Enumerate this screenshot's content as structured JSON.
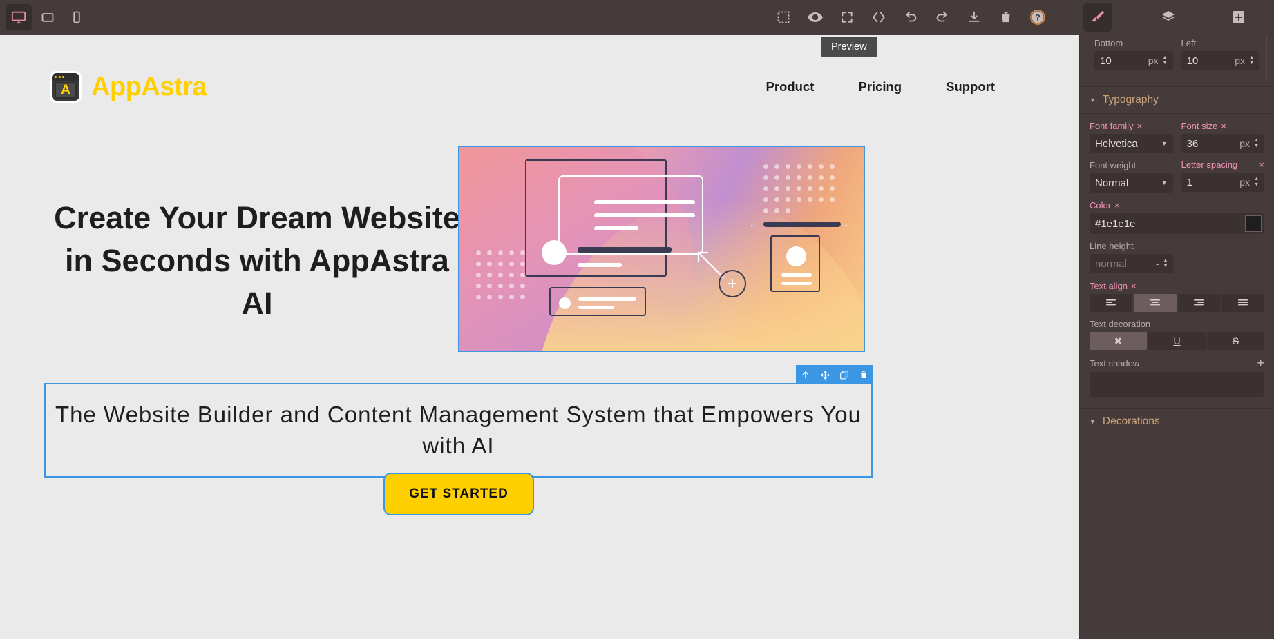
{
  "topbar": {
    "devices": [
      {
        "name": "desktop",
        "label": "Desktop",
        "active": true
      },
      {
        "name": "tablet",
        "label": "Tablet",
        "active": false
      },
      {
        "name": "mobile",
        "label": "Mobile",
        "active": false
      }
    ],
    "tools": [
      {
        "name": "borders",
        "label": "View components"
      },
      {
        "name": "preview",
        "label": "Preview"
      },
      {
        "name": "fullscreen",
        "label": "Fullscreen"
      },
      {
        "name": "code",
        "label": "View code"
      },
      {
        "name": "undo",
        "label": "Undo"
      },
      {
        "name": "redo",
        "label": "Redo"
      },
      {
        "name": "import",
        "label": "Import"
      },
      {
        "name": "clear",
        "label": "Clear canvas"
      },
      {
        "name": "help",
        "label": "Help"
      }
    ],
    "panels": [
      {
        "name": "style-manager",
        "label": "Style Manager",
        "active": true
      },
      {
        "name": "layer-manager",
        "label": "Layer Manager",
        "active": false
      },
      {
        "name": "blocks",
        "label": "Open Blocks",
        "active": false
      }
    ],
    "tooltip": "Preview"
  },
  "site": {
    "logo_text": "AppAstra",
    "logo_letter": "A",
    "nav": [
      "Product",
      "Pricing",
      "Support"
    ],
    "headline": "Create Your Dream Website in Seconds with AppAstra AI",
    "subheading": "The Website Builder and Content Management System that Empowers You with AI",
    "cta": "GET STARTED"
  },
  "selection_toolbar": [
    {
      "name": "select-parent",
      "label": "Select parent"
    },
    {
      "name": "move",
      "label": "Move"
    },
    {
      "name": "copy",
      "label": "Copy"
    },
    {
      "name": "delete",
      "label": "Delete"
    }
  ],
  "style_panel": {
    "spacing": {
      "bottom": {
        "label": "Bottom",
        "value": "10",
        "unit": "px"
      },
      "left": {
        "label": "Left",
        "value": "10",
        "unit": "px"
      }
    },
    "typography": {
      "title": "Typography",
      "font_family": {
        "label": "Font family",
        "value": "Helvetica",
        "cleared": "×"
      },
      "font_size": {
        "label": "Font size",
        "value": "36",
        "unit": "px",
        "cleared": "×"
      },
      "font_weight": {
        "label": "Font weight",
        "value": "Normal"
      },
      "letter_spacing": {
        "label": "Letter spacing",
        "value": "1",
        "unit": "px",
        "cleared": "×"
      },
      "color": {
        "label": "Color",
        "value": "#1e1e1e",
        "cleared": "×"
      },
      "line_height": {
        "label": "Line height",
        "value": "normal",
        "unit": "-"
      },
      "text_align": {
        "label": "Text align",
        "cleared": "×",
        "active": 1,
        "options": [
          "left",
          "center",
          "right",
          "justify"
        ]
      },
      "text_decoration": {
        "label": "Text decoration",
        "active": 0,
        "options": [
          "none",
          "underline",
          "line-through"
        ],
        "glyphs": [
          "✖",
          "U",
          "S"
        ]
      },
      "text_shadow": {
        "label": "Text shadow",
        "add": "+"
      }
    },
    "decorations": {
      "title": "Decorations"
    }
  },
  "colors": {
    "accent_pink": "#ef92b6",
    "selection_blue": "#3b97e3",
    "brand_yellow": "#ffd000",
    "panel_bg": "#463b3b",
    "canvas_bg": "#eaeaea",
    "text_dark": "#1e1e1e"
  }
}
